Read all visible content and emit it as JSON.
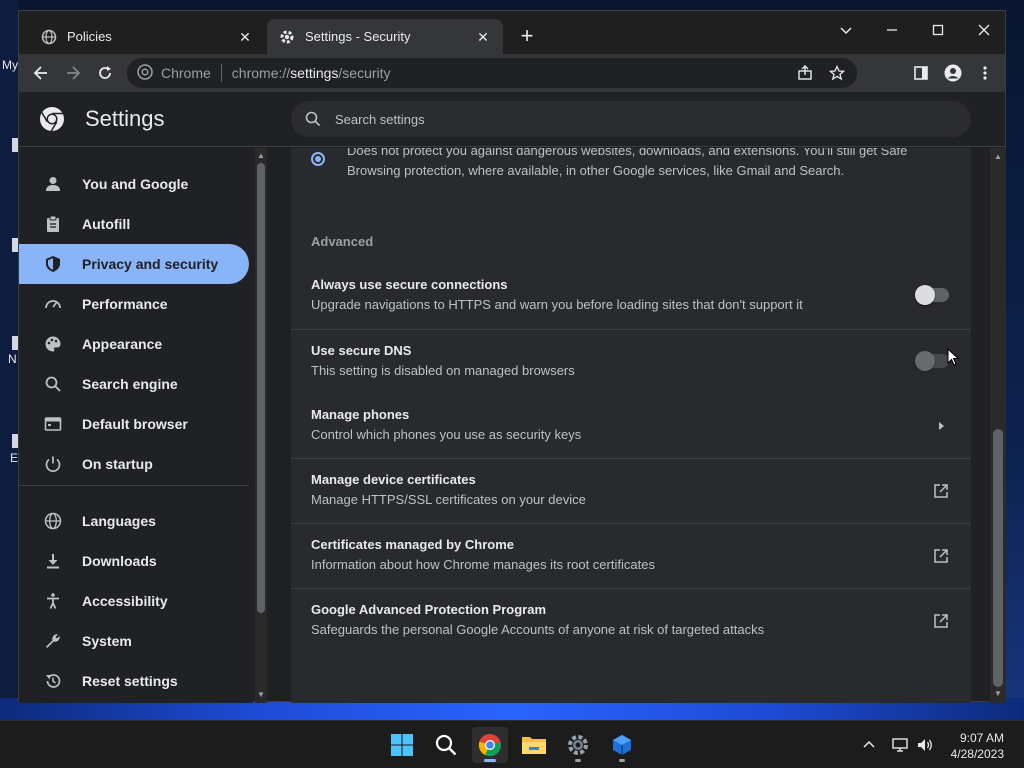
{
  "desktop": {
    "labels": [
      "My",
      "N",
      "E"
    ]
  },
  "tabs": [
    {
      "title": "Policies",
      "icon": "globe-icon",
      "active": false
    },
    {
      "title": "Settings - Security",
      "icon": "gear-icon",
      "active": true
    }
  ],
  "toolbar": {
    "site_label": "Chrome",
    "url_prefix": "chrome://",
    "url_host": "settings",
    "url_path": "/security"
  },
  "settings": {
    "title": "Settings",
    "search_placeholder": "Search settings"
  },
  "sidebar": {
    "items": [
      {
        "label": "You and Google",
        "icon": "person-icon",
        "active": false
      },
      {
        "label": "Autofill",
        "icon": "clipboard-icon",
        "active": false
      },
      {
        "label": "Privacy and security",
        "icon": "shield-icon",
        "active": true
      },
      {
        "label": "Performance",
        "icon": "speedometer-icon",
        "active": false
      },
      {
        "label": "Appearance",
        "icon": "palette-icon",
        "active": false
      },
      {
        "label": "Search engine",
        "icon": "search-icon",
        "active": false
      },
      {
        "label": "Default browser",
        "icon": "browser-icon",
        "active": false
      },
      {
        "label": "On startup",
        "icon": "power-icon",
        "active": false
      },
      {
        "label": "Languages",
        "icon": "globe-icon",
        "active": false
      },
      {
        "label": "Downloads",
        "icon": "download-icon",
        "active": false
      },
      {
        "label": "Accessibility",
        "icon": "accessibility-icon",
        "active": false
      },
      {
        "label": "System",
        "icon": "wrench-icon",
        "active": false
      },
      {
        "label": "Reset settings",
        "icon": "history-icon",
        "active": false
      }
    ]
  },
  "content": {
    "radio_text": "Does not protect you against dangerous websites, downloads, and extensions. You'll still get Safe Browsing protection, where available, in other Google services, like Gmail and Search.",
    "advanced_label": "Advanced",
    "rows": [
      {
        "title": "Always use secure connections",
        "sub": "Upgrade navigations to HTTPS and warn you before loading sites that don't support it",
        "action": "toggle",
        "state": "off"
      },
      {
        "title": "Use secure DNS",
        "sub": "This setting is disabled on managed browsers",
        "action": "toggle",
        "state": "disabled"
      },
      {
        "title": "Manage phones",
        "sub": "Control which phones you use as security keys",
        "action": "arrow"
      },
      {
        "title": "Manage device certificates",
        "sub": "Manage HTTPS/SSL certificates on your device",
        "action": "external"
      },
      {
        "title": "Certificates managed by Chrome",
        "sub": "Information about how Chrome manages its root certificates",
        "action": "external"
      },
      {
        "title": "Google Advanced Protection Program",
        "sub": "Safeguards the personal Google Accounts of anyone at risk of targeted attacks",
        "action": "external"
      }
    ]
  },
  "taskbar": {
    "time": "9:07 AM",
    "date": "4/28/2023"
  },
  "colors": {
    "accent": "#8ab4f8",
    "surface": "#292a2d",
    "background": "#202124"
  }
}
